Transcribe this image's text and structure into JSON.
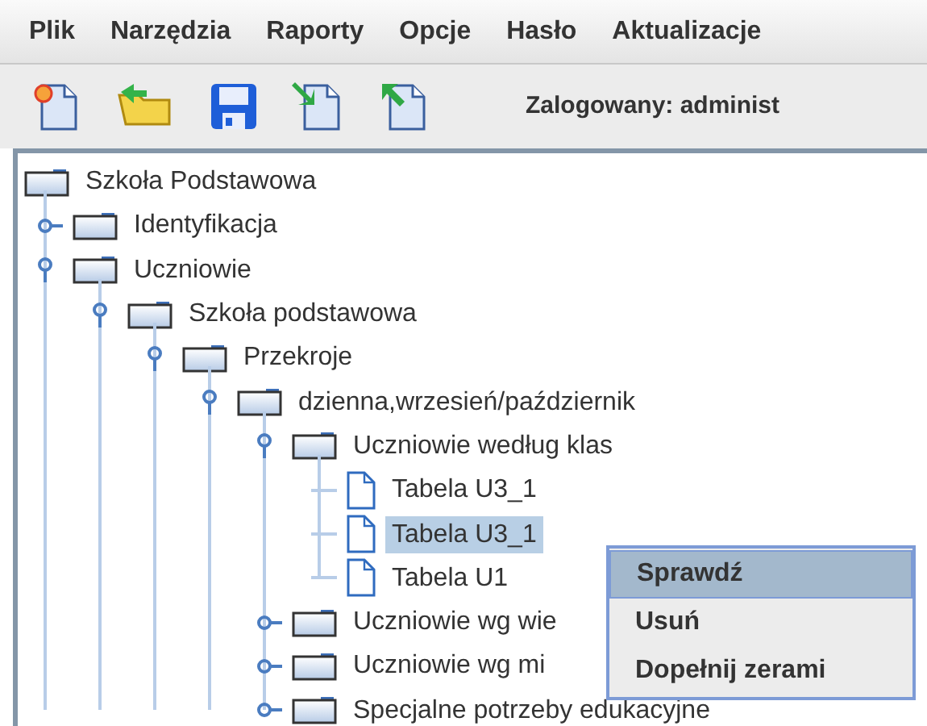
{
  "menu_bar": [
    {
      "label": "Plik"
    },
    {
      "label": "Narzędzia"
    },
    {
      "label": "Raporty"
    },
    {
      "label": "Opcje"
    },
    {
      "label": "Hasło"
    },
    {
      "label": "Aktualizacje"
    }
  ],
  "toolbar": {
    "tools": [
      {
        "kind": "new"
      },
      {
        "kind": "open"
      },
      {
        "kind": "save"
      },
      {
        "kind": "import"
      },
      {
        "kind": "export"
      }
    ],
    "login_status": "Zalogowany: administ"
  },
  "tree": {
    "label": "Szkoła Podstawowa",
    "kind": "folder",
    "expanded": true,
    "selected": false,
    "children": [
      {
        "label": "Identyfikacja",
        "kind": "folder",
        "expanded": false,
        "selected": false
      },
      {
        "label": "Uczniowie",
        "kind": "folder",
        "expanded": true,
        "selected": false,
        "children": [
          {
            "label": "Szkoła podstawowa",
            "kind": "folder",
            "expanded": true,
            "selected": false,
            "children": [
              {
                "label": "Przekroje",
                "kind": "folder",
                "expanded": true,
                "selected": false,
                "children": [
                  {
                    "label": "dzienna,wrzesień/październik",
                    "kind": "folder",
                    "expanded": true,
                    "selected": false,
                    "children": [
                      {
                        "label": "Uczniowie według klas",
                        "kind": "folder",
                        "expanded": true,
                        "selected": false,
                        "children": [
                          {
                            "label": "Tabela U3_1",
                            "kind": "file",
                            "selected": false
                          },
                          {
                            "label": "Tabela U3_1",
                            "kind": "file",
                            "selected": true
                          },
                          {
                            "label": "Tabela U1",
                            "kind": "file",
                            "selected": false
                          }
                        ]
                      },
                      {
                        "label": "Uczniowie wg wie",
                        "kind": "folder",
                        "expanded": false,
                        "selected": false
                      },
                      {
                        "label": "Uczniowie wg mi",
                        "kind": "folder",
                        "expanded": false,
                        "selected": false
                      },
                      {
                        "label": "Specjalne potrzeby edukacyjne",
                        "kind": "folder",
                        "expanded": false,
                        "selected": false
                      }
                    ]
                  }
                ]
              }
            ]
          }
        ]
      }
    ]
  },
  "context_menu": [
    {
      "label": "Sprawdź",
      "highlighted": true
    },
    {
      "label": "Usuń",
      "highlighted": false
    },
    {
      "label": "Dopełnij zerami",
      "highlighted": false
    }
  ]
}
